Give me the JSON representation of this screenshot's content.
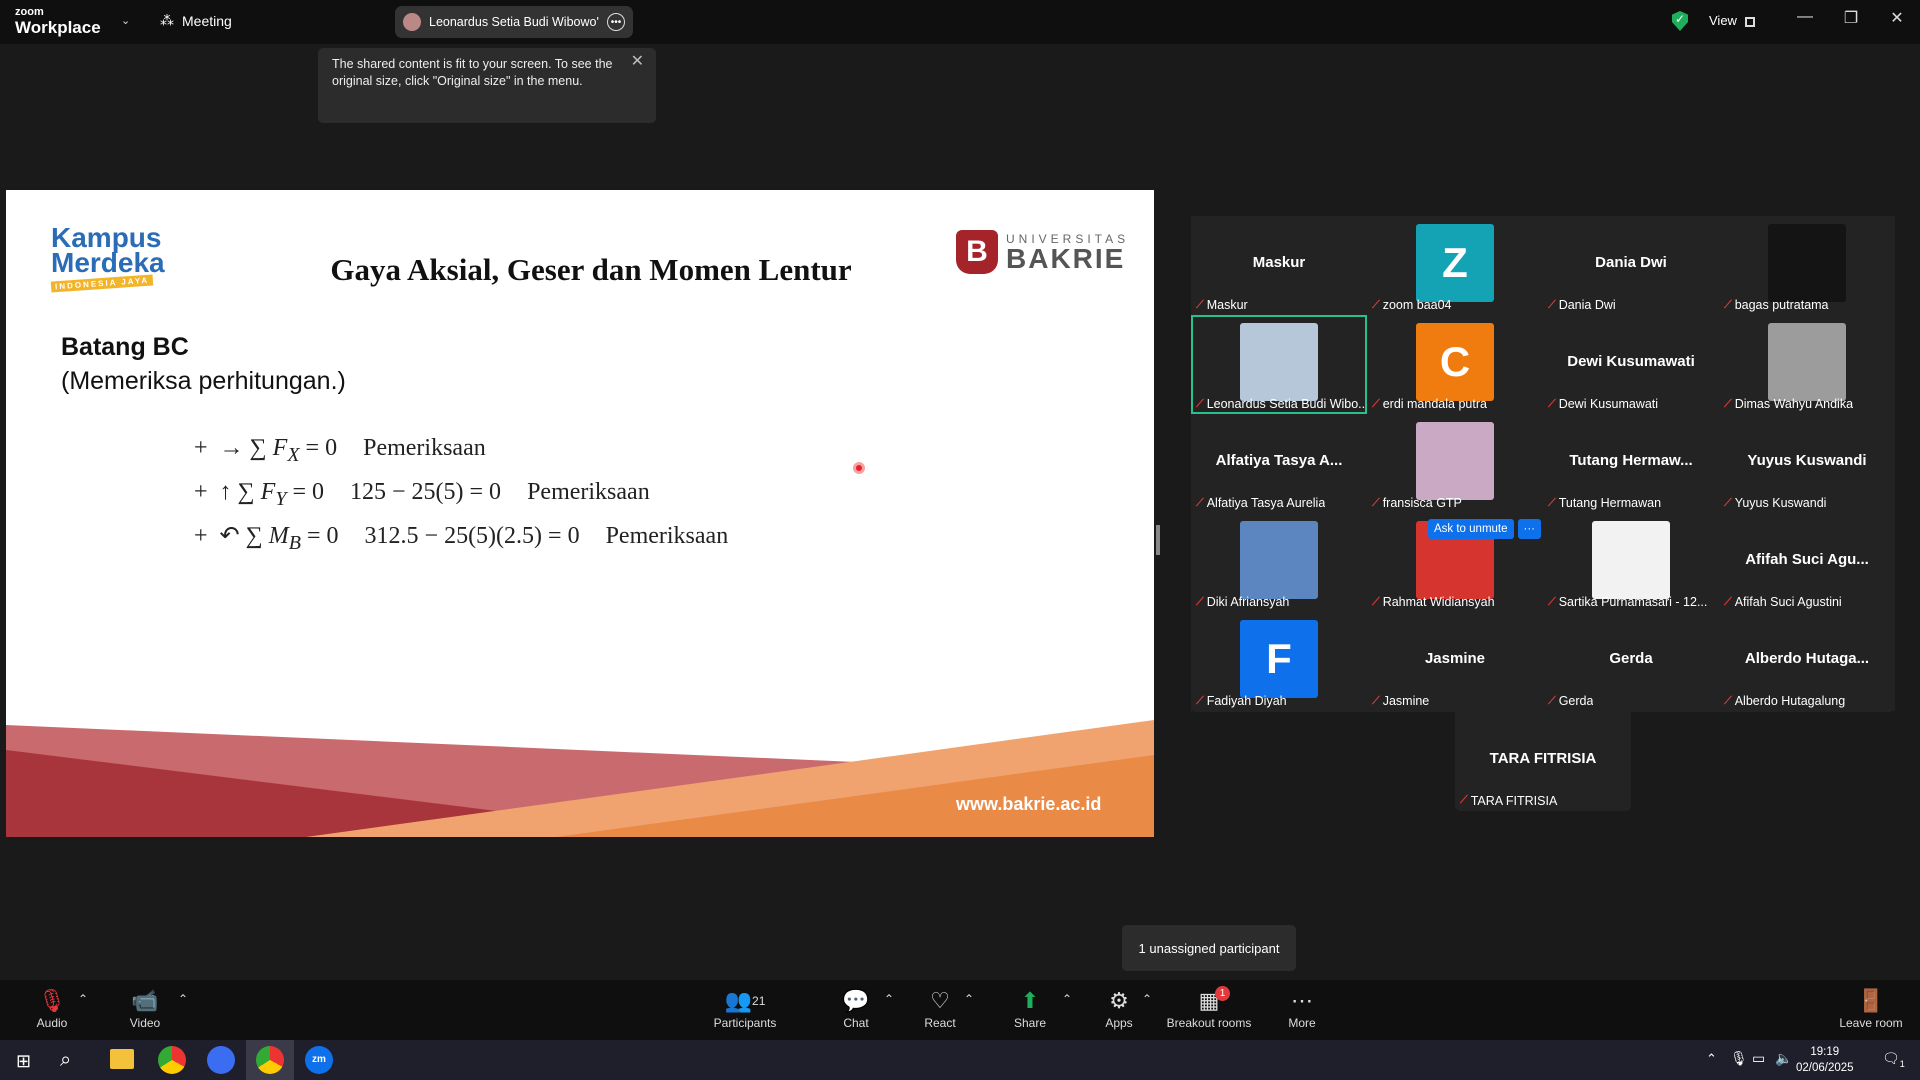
{
  "topbar": {
    "brand_small": "zoom",
    "brand_large": "Workplace",
    "meeting_label": "Meeting",
    "share_label": "Leonardus Setia Budi Wibowo's sc",
    "view_label": "View"
  },
  "tooltip": {
    "text": "The shared content is fit to your screen. To see the original size, click \"Original size\" in the menu."
  },
  "slide": {
    "logo_line1": "Kampus",
    "logo_line2": "Merdeka",
    "logo_line3": "INDONESIA JAYA",
    "title": "Gaya Aksial, Geser dan Momen Lentur",
    "univ_small": "UNIVERSITAS",
    "univ_large": "BAKRIE",
    "heading": "Batang BC",
    "subheading": "(Memeriksa perhitungan.)",
    "eq1_check": "Pemeriksaan",
    "eq2_calc": "125 − 25(5) = 0",
    "eq2_check": "Pemeriksaan",
    "eq3_calc": "312.5 − 25(5)(2.5) = 0",
    "eq3_check": "Pemeriksaan",
    "url": "www.bakrie.ac.id"
  },
  "gallery": {
    "tiles": [
      {
        "label": "Maskur",
        "big": "Maskur"
      },
      {
        "label": "zoom baa04",
        "initial": "Z",
        "color": "#13a3b5"
      },
      {
        "label": "Dania Dwi",
        "big": "Dania Dwi"
      },
      {
        "label": "bagas putratama"
      },
      {
        "label": "Leonardus Setia Budi Wibo..."
      },
      {
        "label": "erdi mandala putra",
        "initial": "C",
        "color": "#f07b0e"
      },
      {
        "label": "Dewi Kusumawati",
        "big": "Dewi Kusumawati"
      },
      {
        "label": "Dimas Wahyu Andika"
      },
      {
        "label": "Alfatiya Tasya Aurelia",
        "big": "Alfatiya Tasya A..."
      },
      {
        "label": "fransisca GTP"
      },
      {
        "label": "Tutang Hermawan",
        "big": "Tutang  Hermaw..."
      },
      {
        "label": "Yuyus Kuswandi",
        "big": "Yuyus Kuswandi"
      },
      {
        "label": "Diki Afriansyah"
      },
      {
        "label": "Rahmat Widiansyah"
      },
      {
        "label": "Sartika Purnamasari - 12..."
      },
      {
        "label": "Afifah Suci Agustini",
        "big": "Afifah  Suci  Agu..."
      },
      {
        "label": "Fadiyah Diyah",
        "initial": "F",
        "color": "#0e71eb"
      },
      {
        "label": "Jasmine",
        "big": "Jasmine"
      },
      {
        "label": "Gerda",
        "big": "Gerda"
      },
      {
        "label": "Alberdo Hutagalung",
        "big": "Alberdo  Hutaga..."
      }
    ],
    "tara": {
      "label": "TARA FITRISIA",
      "big": "TARA FITRISIA"
    },
    "ask_unmute": "Ask to unmute",
    "more_dots": "···"
  },
  "breakout_tooltip": "1 unassigned participant",
  "toolbar": {
    "audio": "Audio",
    "video": "Video",
    "participants": "Participants",
    "participants_count": "21",
    "chat": "Chat",
    "react": "React",
    "share": "Share",
    "apps": "Apps",
    "breakout": "Breakout rooms",
    "breakout_badge": "1",
    "more": "More",
    "leave": "Leave room"
  },
  "taskbar": {
    "time": "19:19",
    "date": "02/06/2025",
    "notif_count": "1"
  }
}
